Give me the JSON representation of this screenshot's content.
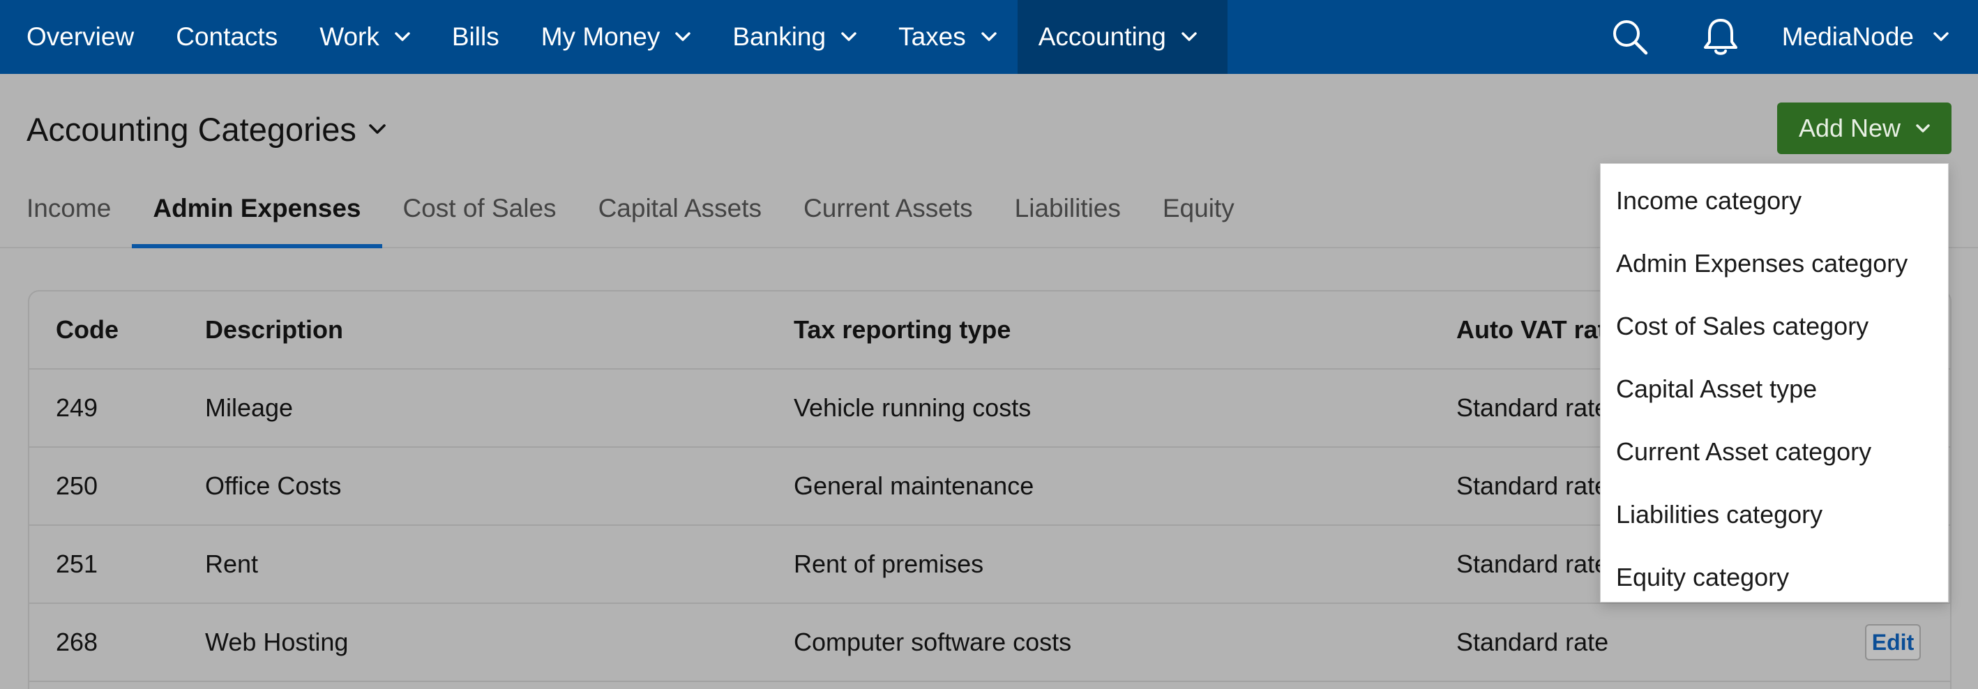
{
  "nav": {
    "items": [
      {
        "label": "Overview",
        "dropdown": false
      },
      {
        "label": "Contacts",
        "dropdown": false
      },
      {
        "label": "Work",
        "dropdown": true
      },
      {
        "label": "Bills",
        "dropdown": false
      },
      {
        "label": "My Money",
        "dropdown": true
      },
      {
        "label": "Banking",
        "dropdown": true
      },
      {
        "label": "Taxes",
        "dropdown": true
      },
      {
        "label": "Accounting",
        "dropdown": true,
        "active": true
      }
    ],
    "account_label": "MediaNode",
    "icons": {
      "search": "search-icon",
      "notifications": "bell-icon"
    }
  },
  "page": {
    "title": "Accounting Categories",
    "add_new_label": "Add New"
  },
  "tabs": [
    "Income",
    "Admin Expenses",
    "Cost of Sales",
    "Capital Assets",
    "Current Assets",
    "Liabilities",
    "Equity"
  ],
  "active_tab": "Admin Expenses",
  "table": {
    "headers": {
      "code": "Code",
      "description": "Description",
      "tax": "Tax reporting type",
      "vat": "Auto VAT rate"
    },
    "rows": [
      {
        "code": "249",
        "description": "Mileage",
        "tax": "Vehicle running costs",
        "vat": "Standard rate"
      },
      {
        "code": "250",
        "description": "Office Costs",
        "tax": "General maintenance",
        "vat": "Standard rate"
      },
      {
        "code": "251",
        "description": "Rent",
        "tax": "Rent of premises",
        "vat": "Standard rate"
      },
      {
        "code": "268",
        "description": "Web Hosting",
        "tax": "Computer software costs",
        "vat": "Standard rate",
        "action": "Edit"
      }
    ]
  },
  "dropdown": {
    "items": [
      "Income category",
      "Admin Expenses category",
      "Cost of Sales category",
      "Capital Asset type",
      "Current Asset category",
      "Liabilities category",
      "Equity category"
    ]
  },
  "colors": {
    "nav_bg": "#004a8c",
    "nav_active_bg": "#003a6d",
    "add_new_bg": "#2e6b22",
    "tab_underline": "#0a56a3",
    "overlay_bg": "#b3b3b3"
  }
}
